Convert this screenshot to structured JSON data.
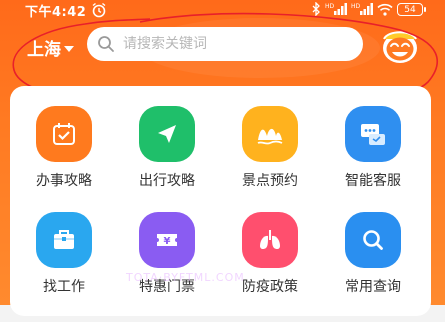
{
  "status_bar": {
    "time": "下午4:42",
    "battery": "54",
    "icons": [
      "alarm-icon",
      "bluetooth-icon",
      "signal-hd-icon",
      "signal-hd-icon",
      "wifi-icon",
      "battery-icon"
    ]
  },
  "header": {
    "city": "上海",
    "search_placeholder": "请搜索关键词",
    "mascot_icon": "smiley-mascot-icon"
  },
  "colors": {
    "header_orange": "#ff6a1a",
    "annotation_red": "#e8202a"
  },
  "services": [
    {
      "label": "办事攻略",
      "icon": "calendar-check-icon",
      "color": "#ff7a1e"
    },
    {
      "label": "出行攻略",
      "icon": "paper-plane-icon",
      "color": "#1fbf6a"
    },
    {
      "label": "景点预约",
      "icon": "scenic-mountains-icon",
      "color": "#ffb21e"
    },
    {
      "label": "智能客服",
      "icon": "chat-bubbles-icon",
      "color": "#2f8ff0"
    },
    {
      "label": "找工作",
      "icon": "briefcase-icon",
      "color": "#2aa7ef"
    },
    {
      "label": "特惠门票",
      "icon": "ticket-yen-icon",
      "color": "#8a5cf2"
    },
    {
      "label": "防疫政策",
      "icon": "lungs-icon",
      "color": "#ff4f6e"
    },
    {
      "label": "常用查询",
      "icon": "magnifier-icon",
      "color": "#2a8ff0"
    }
  ],
  "watermark": "TOTA·BYFTML.COM"
}
